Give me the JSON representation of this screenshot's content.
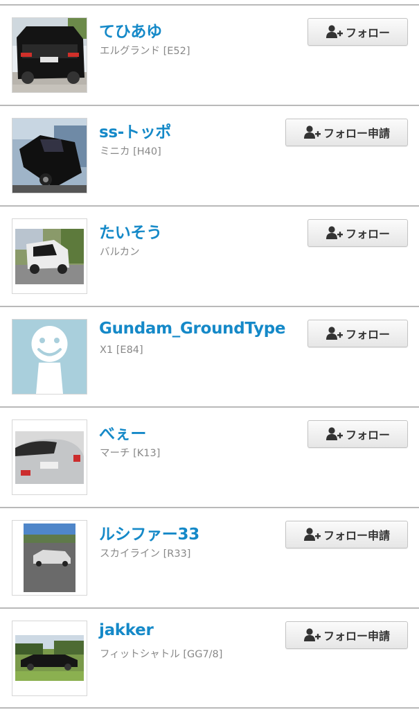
{
  "icons": {
    "follow": "person-add-icon"
  },
  "colors": {
    "username": "#1589c8",
    "car_text": "#888888",
    "divider": "#b9b9b9"
  },
  "users": [
    {
      "name": "てひあゆ",
      "car": "エルグランド [E52]",
      "button": "フォロー"
    },
    {
      "name": "ss-トッポ",
      "car": "ミニカ [H40]",
      "button": "フォロー申請"
    },
    {
      "name": "たいそう",
      "car": "バルカン",
      "button": "フォロー"
    },
    {
      "name": "Gundam_GroundType",
      "car": "X1 [E84]",
      "button": "フォロー"
    },
    {
      "name": "べぇー",
      "car": "マーチ [K13]",
      "button": "フォロー"
    },
    {
      "name": "ルシファー33",
      "car": "スカイライン [R33]",
      "button": "フォロー申請"
    },
    {
      "name": "jakker",
      "car": "フィットシャトル [GG7/8]",
      "button": "フォロー申請"
    }
  ]
}
